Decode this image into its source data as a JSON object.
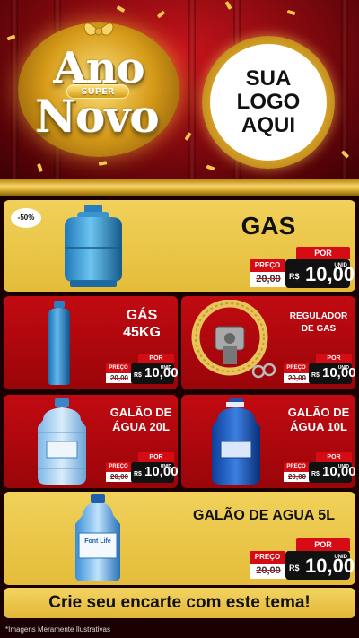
{
  "header": {
    "title_line1": "Ano",
    "title_badge": "SUPER",
    "title_line2": "Novo",
    "logo_line1": "SUA",
    "logo_line2": "LOGO",
    "logo_line3": "AQUI"
  },
  "colors": {
    "red": "#c20a12",
    "gold": "#e9c74a",
    "dark": "#111111"
  },
  "products": [
    {
      "title": "GAS",
      "badge": "-50%",
      "label_por": "POR",
      "label_preco": "PREÇO",
      "currency": "R$",
      "old_price": "20,00",
      "new_price": "10,00",
      "unit": "UNID",
      "icon": "gas-cylinder-icon"
    },
    {
      "title_line1": "GÁS",
      "title_line2": "45KG",
      "label_por": "POR",
      "label_preco": "PREÇO",
      "currency": "R$",
      "old_price": "20,00",
      "new_price": "10,00",
      "unit": "UNID",
      "icon": "gas-bottle-icon"
    },
    {
      "title_line1": "REGULADOR",
      "title_line2": "DE GAS",
      "label_por": "POR",
      "label_preco": "PREÇO",
      "currency": "R$",
      "old_price": "20,00",
      "new_price": "10,00",
      "unit": "UNID",
      "icon": "gas-regulator-icon"
    },
    {
      "title_line1": "GALÃO DE",
      "title_line2": "ÁGUA 20L",
      "label_por": "POR",
      "label_preco": "PREÇO",
      "currency": "R$",
      "old_price": "20,00",
      "new_price": "10,00",
      "unit": "UNID",
      "icon": "water-jug-20l-icon"
    },
    {
      "title_line1": "GALÃO DE",
      "title_line2": "ÁGUA 10L",
      "label_por": "POR",
      "label_preco": "PREÇO",
      "currency": "R$",
      "old_price": "20,00",
      "new_price": "10,00",
      "unit": "UNID",
      "icon": "water-jug-10l-icon"
    },
    {
      "title": "GALÃO DE AGUA 5L",
      "bottle_brand": "Font Life",
      "label_por": "POR",
      "label_preco": "PREÇO",
      "currency": "R$",
      "old_price": "20,00",
      "new_price": "10,00",
      "unit": "UNID",
      "icon": "water-bottle-5l-icon"
    }
  ],
  "footer": {
    "cta": "Crie seu encarte com este tema!",
    "disclaimer": "*Imagens Meramente Ilustrativas"
  }
}
